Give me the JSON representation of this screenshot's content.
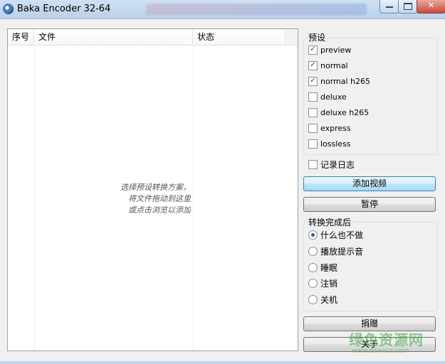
{
  "window": {
    "title": "Baka Encoder 32-64"
  },
  "list": {
    "columns": [
      "序号",
      "文件",
      "状态"
    ],
    "hint_lines": [
      "选择预设转换方案，",
      "将文件拖动到这里",
      "或点击浏览以添加"
    ]
  },
  "presets": {
    "title": "预设",
    "items": [
      {
        "label": "preview",
        "checked": true
      },
      {
        "label": "normal",
        "checked": true
      },
      {
        "label": "normal h265",
        "checked": true
      },
      {
        "label": "deluxe",
        "checked": false
      },
      {
        "label": "deluxe h265",
        "checked": false
      },
      {
        "label": "express",
        "checked": false
      },
      {
        "label": "lossless",
        "checked": false
      }
    ]
  },
  "log_checkbox": {
    "label": "记录日志",
    "checked": false
  },
  "buttons": {
    "add_video": "添加视频",
    "pause": "暂停",
    "donate": "捐赠",
    "about": "关于"
  },
  "after_conversion": {
    "title": "转换完成后",
    "options": [
      {
        "label": "什么也不做",
        "selected": true
      },
      {
        "label": "播放提示音",
        "selected": false
      },
      {
        "label": "睡眠",
        "selected": false
      },
      {
        "label": "注销",
        "selected": false
      },
      {
        "label": "关机",
        "selected": false
      }
    ]
  },
  "watermark": {
    "text": "绿色资源网",
    "url": "www.downcc.com"
  },
  "icons": {
    "app": "app-icon",
    "minimize": "minimize-icon",
    "maximize": "maximize-icon",
    "close": "close-icon"
  }
}
